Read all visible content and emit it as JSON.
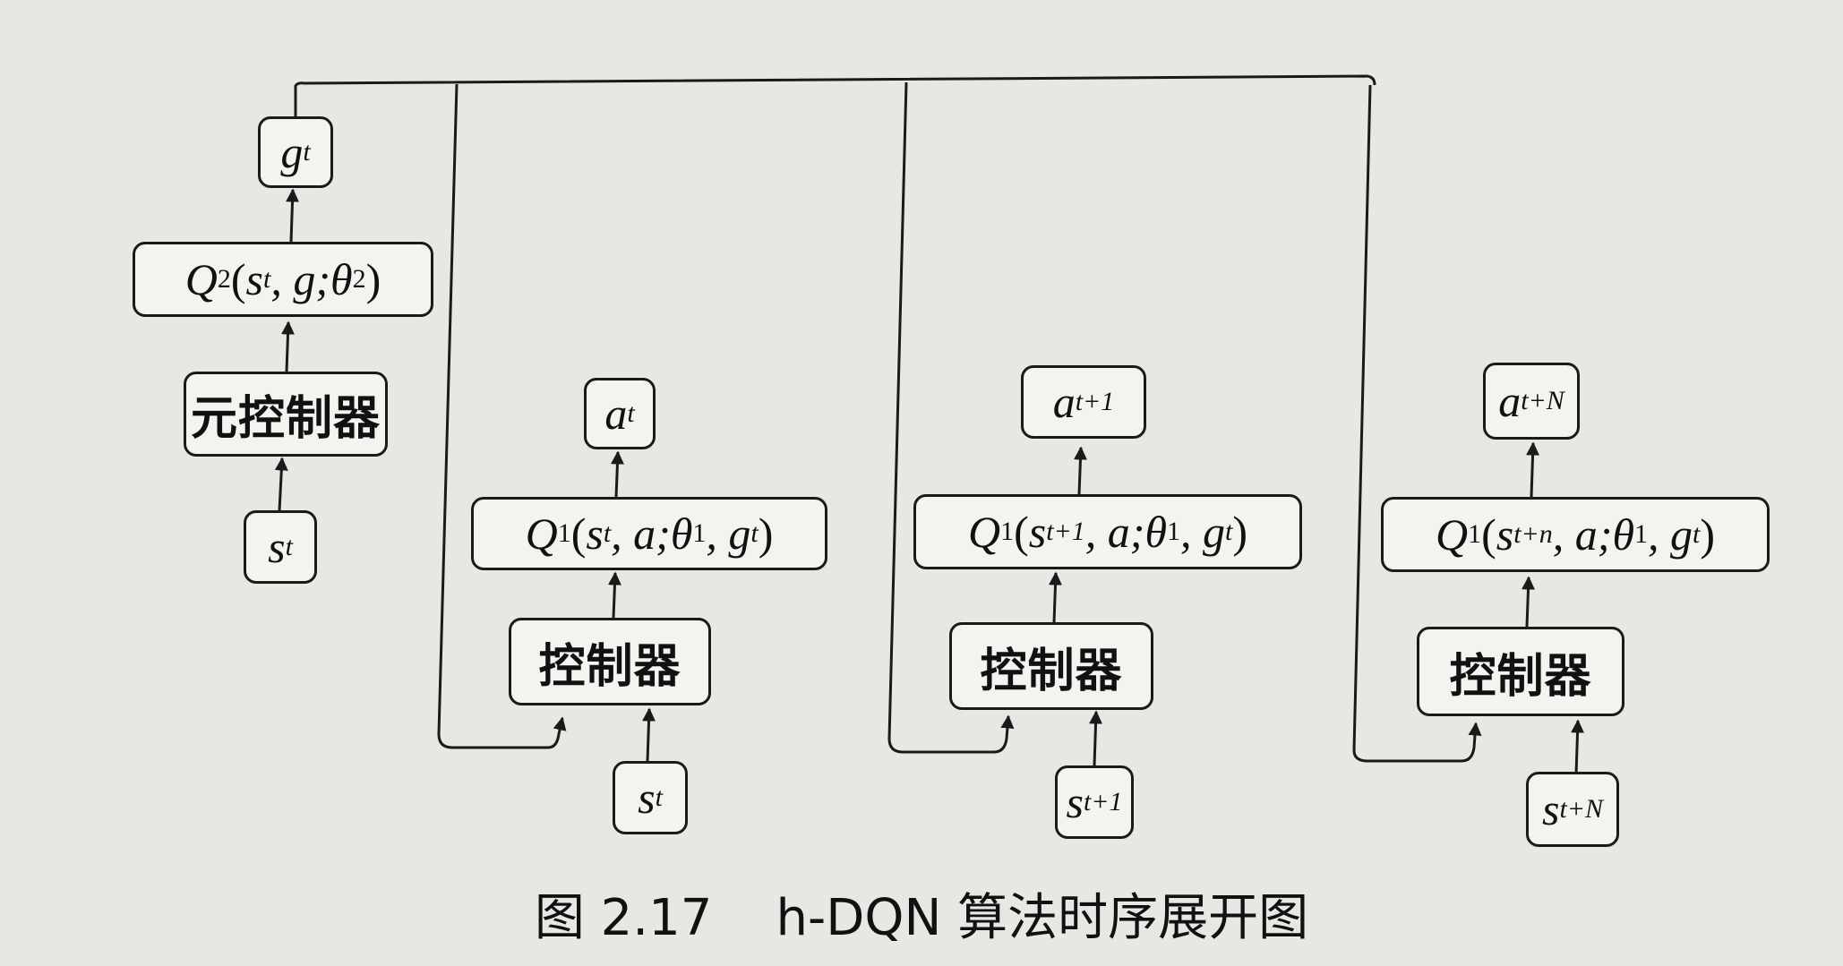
{
  "caption": "图 2.17    h-DQN 算法时序展开图",
  "meta_controller": {
    "goal": {
      "sym": "g",
      "sub": "t"
    },
    "q2": {
      "sym": "Q",
      "sub": "2",
      "args": [
        {
          "sym": "s",
          "sub": "t"
        },
        {
          "text": ", g; "
        },
        {
          "sym": "θ",
          "sub": "2"
        },
        {
          "text": ")"
        }
      ]
    },
    "label": "元控制器",
    "state": {
      "sym": "s",
      "sub": "t"
    }
  },
  "controllers": [
    {
      "action": {
        "sym": "a",
        "sub": "t"
      },
      "q1": "Q₁(s_t, a; θ₁, g_t)",
      "label": "控制器",
      "state": {
        "sym": "s",
        "sub": "t"
      },
      "q1_state_sub": "t"
    },
    {
      "action": {
        "sym": "a",
        "sub": "t+1"
      },
      "q1": "Q₁(s_{t+1}, a; θ₁, g_t)",
      "label": "控制器",
      "state": {
        "sym": "s",
        "sub": "t+1"
      },
      "q1_state_sub": "t+1"
    },
    {
      "action": {
        "sym": "a",
        "sub": "t+N"
      },
      "q1": "Q₁(s_{t+n}, a; θ₁, g_t)",
      "label": "控制器",
      "state": {
        "sym": "s",
        "sub": "t+N"
      },
      "q1_state_sub": "t+n"
    }
  ],
  "q1_parts": {
    "prefix_sym": "Q",
    "prefix_sub": "1",
    "a": ", a; ",
    "theta": "θ",
    "theta_sub": "1",
    "g": ", g",
    "g_sub": "t",
    "close": ")",
    "s": "s",
    "open": "("
  },
  "colors": {
    "line": "#1a1a1a",
    "box_fill": "#f4f3f0",
    "paper": "#e9e7e3"
  }
}
